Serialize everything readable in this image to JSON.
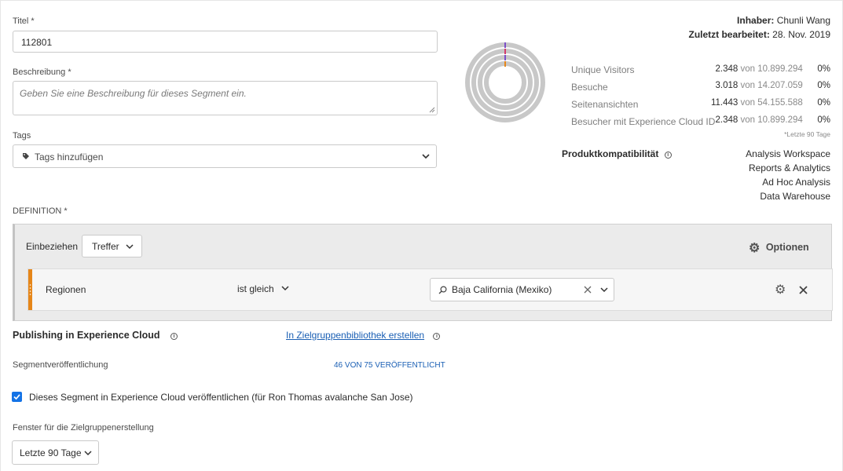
{
  "form": {
    "title_label": "Titel *",
    "title_value": "112801",
    "description_label": "Beschreibung *",
    "description_placeholder": "Geben Sie eine Beschreibung für dieses Segment ein.",
    "tags_label": "Tags",
    "tags_placeholder": "Tags hinzufügen"
  },
  "meta": {
    "owner_label": "Inhaber:",
    "owner_value": "Chunli Wang",
    "edited_label": "Zuletzt bearbeitet:",
    "edited_value": "28. Nov. 2019"
  },
  "stats": [
    {
      "label": "Unique Visitors",
      "value": "2.348",
      "of": "von 10.899.294",
      "pct": "0%"
    },
    {
      "label": "Besuche",
      "value": "3.018",
      "of": "von 14.207.059",
      "pct": "0%"
    },
    {
      "label": "Seitenansichten",
      "value": "11.443",
      "of": "von 54.155.588",
      "pct": "0%"
    },
    {
      "label": "Besucher mit Experience Cloud ID",
      "value": "2.348",
      "of": "von 10.899.294",
      "pct": "0%"
    }
  ],
  "stats_note": "*Letzte 90 Tage",
  "compatibility": {
    "label": "Produktkompatibilität",
    "items": [
      "Analysis Workspace",
      "Reports & Analytics",
      "Ad Hoc Analysis",
      "Data Warehouse"
    ]
  },
  "definition": {
    "label": "DEFINITION *",
    "include_label": "Einbeziehen",
    "scope_value": "Treffer",
    "options_label": "Optionen",
    "rule": {
      "dimension": "Regionen",
      "operator": "ist gleich",
      "value": "Baja California (Mexiko)"
    }
  },
  "publishing": {
    "title": "Publishing in Experience Cloud",
    "create_link": "In Zielgruppenbibliothek erstellen",
    "segment_pub_label": "Segmentveröffentlichung",
    "segment_pub_count": "46 VON 75 VERÖFFENTLICHT",
    "checkbox_label": "Dieses Segment in Experience Cloud veröffentlichen (für Ron Thomas avalanche San Jose)",
    "checkbox_checked": true,
    "window_label": "Fenster für die Zielgruppenerstellung",
    "window_value": "Letzte 90 Tage"
  },
  "colors": {
    "accent": "#1473e6",
    "rule_handle": "#e68619",
    "ring": "#c8c8c8",
    "ring_mark_a": "#7b4fc9",
    "ring_mark_b": "#d43b6a"
  }
}
